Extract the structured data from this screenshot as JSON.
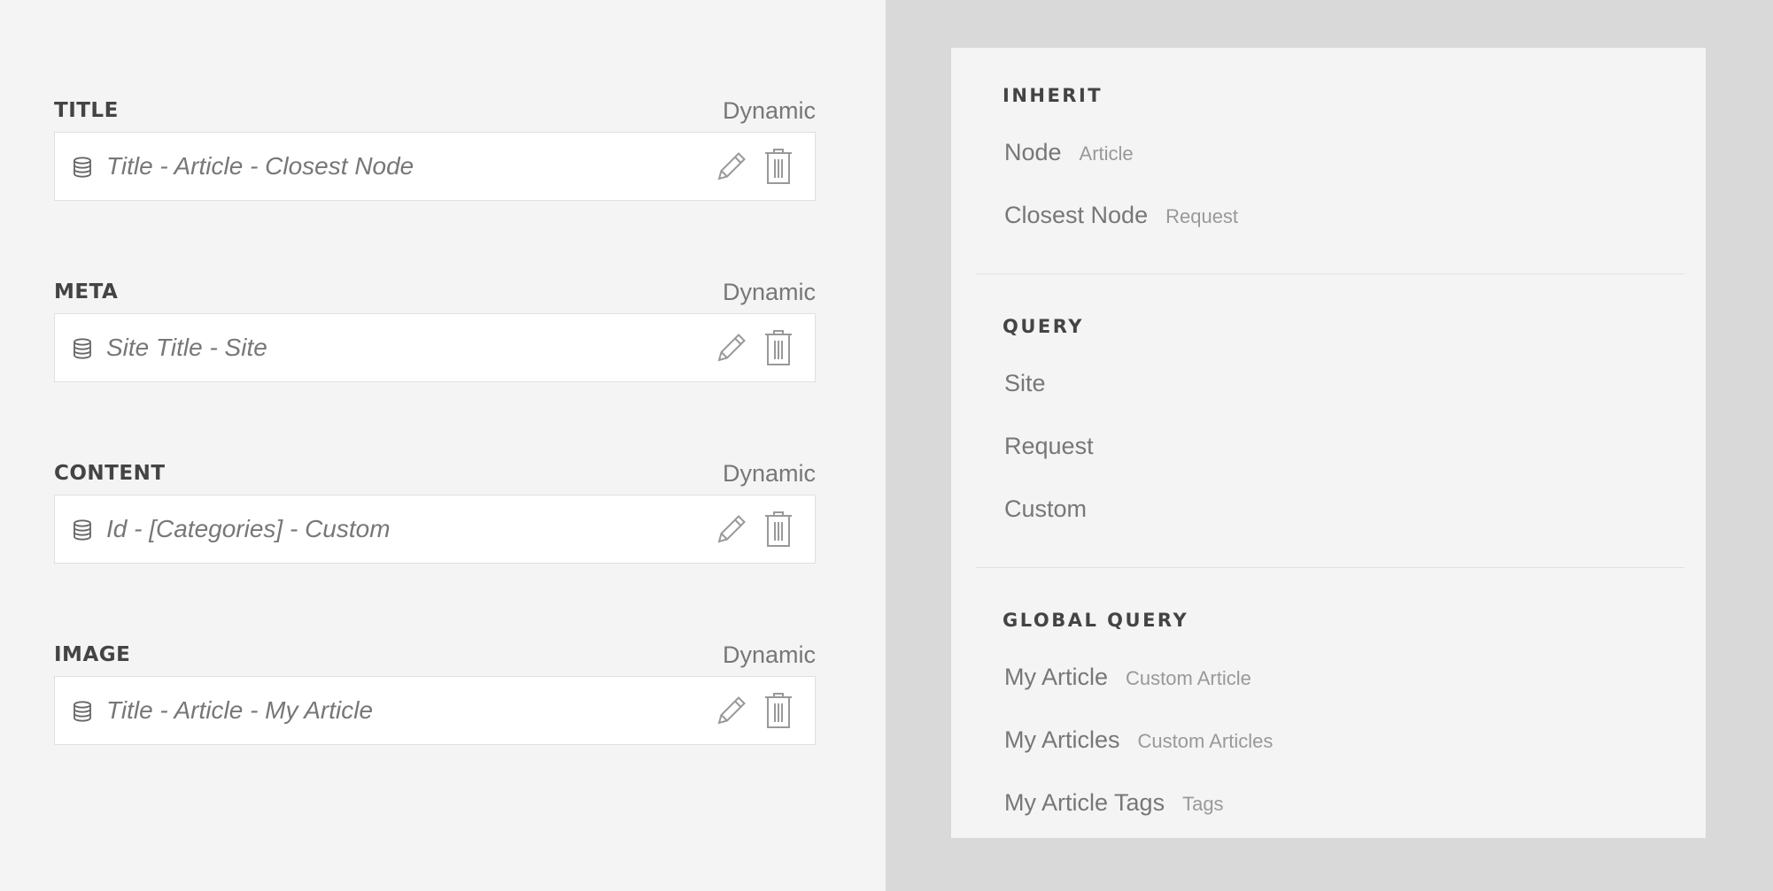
{
  "fields": [
    {
      "label": "TITLE",
      "mode": "Dynamic",
      "value": "Title - Article - Closest Node"
    },
    {
      "label": "META",
      "mode": "Dynamic",
      "value": "Site Title - Site"
    },
    {
      "label": "CONTENT",
      "mode": "Dynamic",
      "value": "Id - [Categories] - Custom"
    },
    {
      "label": "IMAGE",
      "mode": "Dynamic",
      "value": "Title - Article - My Article"
    }
  ],
  "icons": {
    "source": "database-icon",
    "edit": "pencil-icon",
    "delete": "trash-icon"
  },
  "panel": {
    "inherit": {
      "title": "INHERIT",
      "items": [
        {
          "label": "Node",
          "sub": "Article"
        },
        {
          "label": "Closest Node",
          "sub": "Request"
        }
      ]
    },
    "query": {
      "title": "QUERY",
      "items": [
        {
          "label": "Site"
        },
        {
          "label": "Request"
        },
        {
          "label": "Custom"
        }
      ]
    },
    "global_query": {
      "title": "GLOBAL QUERY",
      "items": [
        {
          "label": "My Article",
          "sub": "Custom Article"
        },
        {
          "label": "My Articles",
          "sub": "Custom Articles"
        },
        {
          "label": "My Article Tags",
          "sub": "Tags"
        }
      ]
    }
  },
  "colors": {
    "left_background": "#f4f4f4",
    "right_background": "#d9d9d9",
    "panel_background": "#f4f4f4",
    "field_background": "#ffffff",
    "heading_text": "#444444",
    "muted_text": "#777777"
  }
}
